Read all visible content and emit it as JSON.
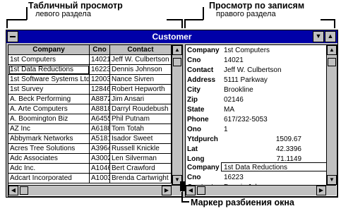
{
  "annotations": {
    "table_view": "Табличный просмотр",
    "table_view_sub": "левого раздела",
    "record_view": "Просмотр по записям",
    "record_view_sub": "правого раздела",
    "split_marker": "Маркер разбиения окна"
  },
  "window": {
    "title": "Customer"
  },
  "table": {
    "columns": [
      "Company",
      "Cno",
      "Contact"
    ],
    "rows": [
      [
        "1st Computers",
        "14021",
        "Jeff W. Culbertson"
      ],
      [
        "1st Data Reductions",
        "16223",
        "Dennis Johnson"
      ],
      [
        "1st Software Systems Ltd.",
        "12003",
        "Nance Sivren"
      ],
      [
        "1st Survey",
        "12846",
        "Robert Hepworth"
      ],
      [
        "A. Beck Performing",
        "A8872",
        "Jim Ansari"
      ],
      [
        "A. Arte Computers",
        "A8818",
        "Darryl Roudebush"
      ],
      [
        "A. Boomington Biz",
        "A6455",
        "Phil Putnam"
      ],
      [
        "AZ Inc",
        "A6188",
        "Tom Totah"
      ],
      [
        "Abbymark Networks",
        "A5181",
        "Isador Sweet"
      ],
      [
        "Acres Tree Solutions",
        "A3964",
        "Russell Knickle"
      ],
      [
        "Adc Associates",
        "A3002",
        "Len Silverman"
      ],
      [
        "Adc Inc.",
        "A1046",
        "Bert Crawford"
      ],
      [
        "Adcart Incorporated",
        "A1003",
        "Brenda Cartwright"
      ]
    ]
  },
  "record1": {
    "fields": [
      {
        "label": "Company",
        "value": "1st Computers"
      },
      {
        "label": "Cno",
        "value": "14021"
      },
      {
        "label": "Contact",
        "value": "Jeff W. Culbertson"
      },
      {
        "label": "Address",
        "value": "5111 Parkway"
      },
      {
        "label": "City",
        "value": "Brookline"
      },
      {
        "label": "Zip",
        "value": "02146"
      },
      {
        "label": "State",
        "value": "MA"
      },
      {
        "label": "Phone",
        "value": "617/232-5053"
      },
      {
        "label": "Ono",
        "value": "1"
      }
    ],
    "numeric": [
      {
        "label": "Ytdpurch",
        "value": "1509.67"
      },
      {
        "label": "Lat",
        "value": "42.3396"
      },
      {
        "label": "Long",
        "value": "71.1149"
      }
    ]
  },
  "record2": {
    "fields": [
      {
        "label": "Company",
        "value": "1st Data Reductions"
      },
      {
        "label": "Cno",
        "value": "16223"
      },
      {
        "label": "Contact",
        "value": "Dennis Johnson"
      }
    ]
  },
  "colors": {
    "titlebar": "#0000a8",
    "chrome": "#c0c0c0"
  }
}
